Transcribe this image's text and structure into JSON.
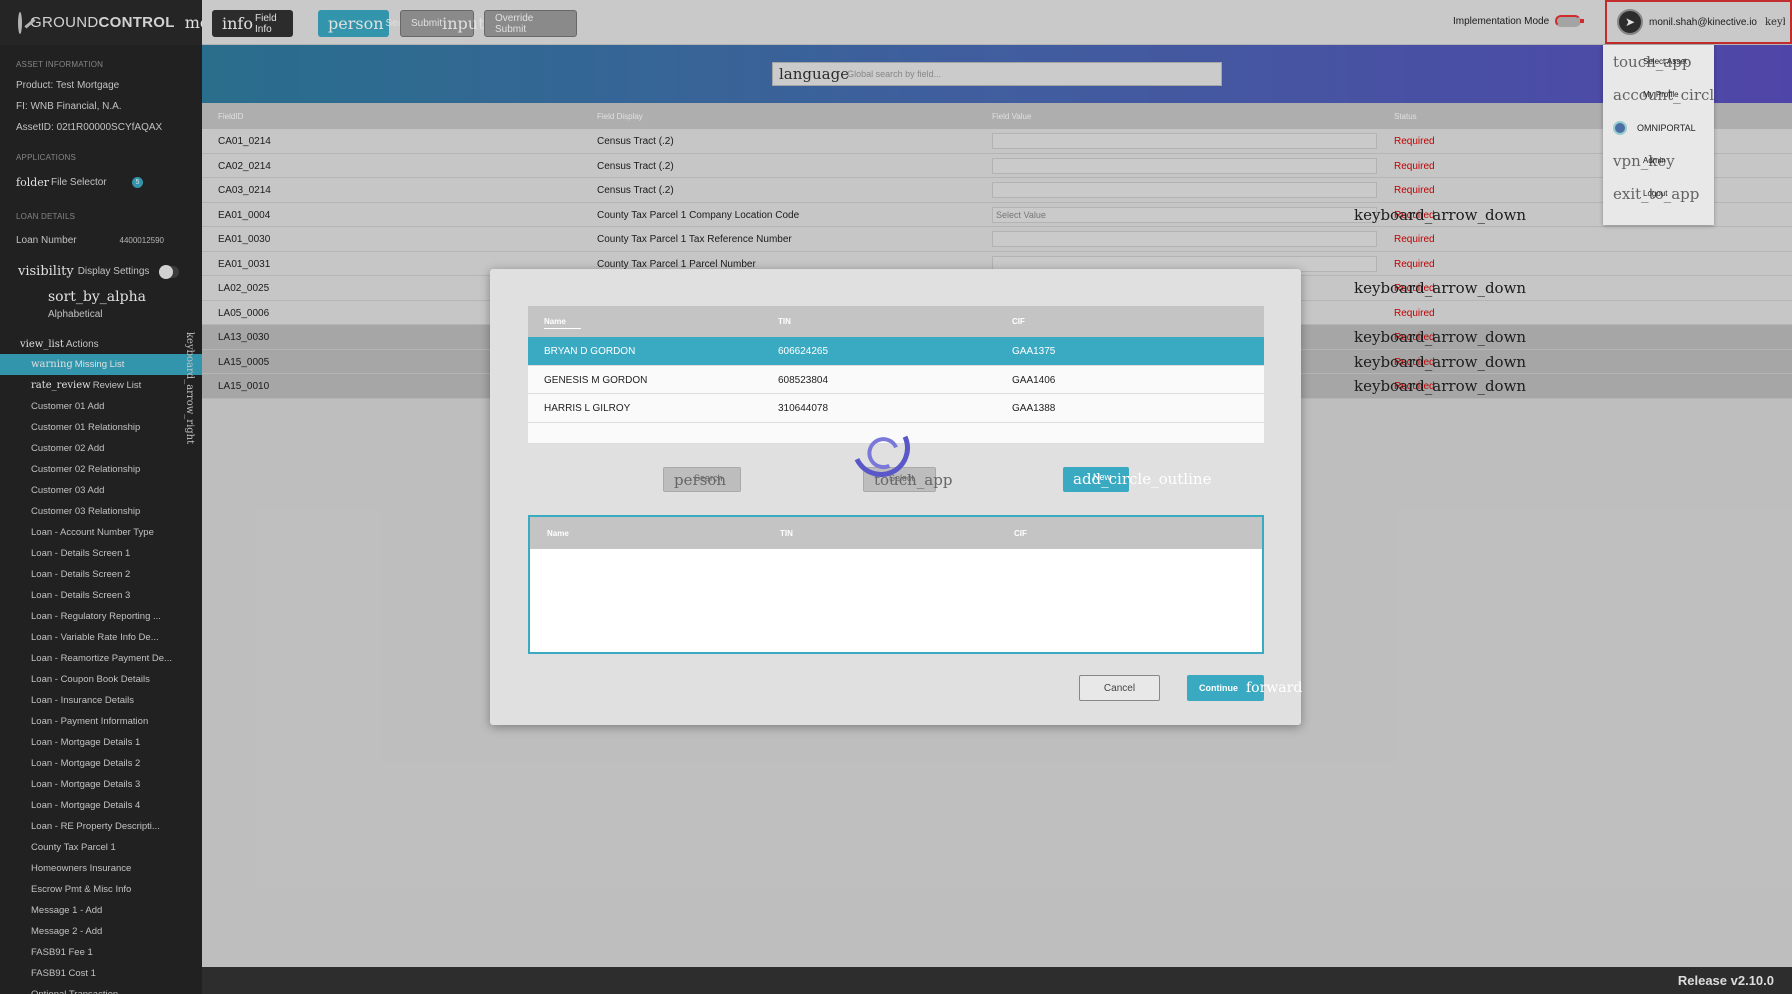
{
  "brand": {
    "name_light": "GROUND",
    "name_bold": "CONTROL",
    "menu_glyph": "menu"
  },
  "sidebar": {
    "asset_title": "ASSET INFORMATION",
    "product": "Product:  Test Mortgage",
    "fi": "FI:  WNB Financial, N.A.",
    "asset_id": "AssetID:  02t1R00000SCYfAQAX",
    "applications_title": "APPLICATIONS",
    "app_icon": "folder",
    "app_label": "File Selector",
    "app_badge": "5",
    "loan_title": "LOAN DETAILS",
    "loan_label": "Loan Number",
    "loan_value": "4400012590",
    "display_icon": "visibility",
    "display_label": "Display Settings",
    "sort_glyph": "sort_by_alpha",
    "sort_label": "Alphabetical",
    "actions_icon": "view_list",
    "actions_label": "Actions",
    "vertical_glyph": "keyboard_arrow_right",
    "items": [
      {
        "glyph": "warning",
        "label": "Missing List",
        "active": true
      },
      {
        "glyph": "rate_review",
        "label": "Review List"
      },
      {
        "label": "Customer 01 Add"
      },
      {
        "label": "Customer 01 Relationship"
      },
      {
        "label": "Customer 02 Add"
      },
      {
        "label": "Customer 02 Relationship"
      },
      {
        "label": "Customer 03 Add"
      },
      {
        "label": "Customer 03 Relationship"
      },
      {
        "label": "Loan - Account Number Type"
      },
      {
        "label": "Loan - Details Screen 1"
      },
      {
        "label": "Loan - Details Screen 2"
      },
      {
        "label": "Loan - Details Screen 3"
      },
      {
        "label": "Loan - Regulatory Reporting ..."
      },
      {
        "label": "Loan - Variable Rate Info De..."
      },
      {
        "label": "Loan - Reamortize Payment De..."
      },
      {
        "label": "Loan - Coupon Book Details"
      },
      {
        "label": "Loan - Insurance Details"
      },
      {
        "label": "Loan - Payment Information"
      },
      {
        "label": "Loan - Mortgage Details 1"
      },
      {
        "label": "Loan - Mortgage Details 2"
      },
      {
        "label": "Loan - Mortgage Details 3"
      },
      {
        "label": "Loan - Mortgage Details 4"
      },
      {
        "label": "Loan - RE Property Descripti..."
      },
      {
        "label": "County Tax Parcel 1"
      },
      {
        "label": "Homeowners Insurance"
      },
      {
        "label": "Escrow Pmt & Misc Info"
      },
      {
        "label": "Message 1 - Add"
      },
      {
        "label": "Message 2 - Add"
      },
      {
        "label": "FASB91 Fee 1"
      },
      {
        "label": "FASB91 Cost 1"
      },
      {
        "label": "Optional Transaction"
      }
    ]
  },
  "toolbar": {
    "field_info_glyph": "info",
    "field_info_label": "Field Info",
    "search_glyph": "person",
    "search_label": "Search",
    "submit_label": "Submit",
    "submit_glyph": "input",
    "override_label": "Override Submit",
    "impl_label": "Implementation Mode",
    "user_email": "monil.shah@kinective.io",
    "user_glyph": "keyboard_arrow_down"
  },
  "dropdown": [
    {
      "glyph": "touch_app",
      "label": "Select Asset"
    },
    {
      "glyph": "account_circle",
      "label": "My Profile"
    },
    {
      "glyph": "",
      "label": "OMNIPORTAL"
    },
    {
      "glyph": "vpn_key",
      "label": "Admin"
    },
    {
      "glyph": "exit_to_app",
      "label": "Logout"
    }
  ],
  "search": {
    "glyph": "language",
    "placeholder": "Global search by field..."
  },
  "table": {
    "headers": [
      "FieldID",
      "Field Display",
      "Field Value",
      "Status"
    ],
    "rows": [
      {
        "id": "CA01_0214",
        "display": "Census Tract (.2)",
        "value": "",
        "status": "Required"
      },
      {
        "id": "CA02_0214",
        "display": "Census Tract (.2)",
        "value": "",
        "status": "Required"
      },
      {
        "id": "CA03_0214",
        "display": "Census Tract (.2)",
        "value": "",
        "status": "Required"
      },
      {
        "id": "EA01_0004",
        "display": "County Tax Parcel 1 Company Location Code",
        "value": "Select Value",
        "status": "Required",
        "dropdown": "keyboard_arrow_down"
      },
      {
        "id": "EA01_0030",
        "display": "County Tax Parcel 1 Tax Reference Number",
        "value": "",
        "status": "Required"
      },
      {
        "id": "EA01_0031",
        "display": "County Tax Parcel 1 Parcel Number",
        "value": "",
        "status": "Required"
      },
      {
        "id": "LA02_0025",
        "display": "",
        "value": "",
        "status": "Required",
        "dropdown": "keyboard_arrow_down"
      },
      {
        "id": "LA05_0006",
        "display": "",
        "value": "",
        "status": "Required"
      },
      {
        "id": "LA13_0030",
        "display": "",
        "value": "",
        "status": "Required",
        "dropdown": "keyboard_arrow_down",
        "dim": true
      },
      {
        "id": "LA15_0005",
        "display": "",
        "value": "",
        "status": "Required",
        "dropdown": "keyboard_arrow_down",
        "dim": true
      },
      {
        "id": "LA15_0010",
        "display": "",
        "value": "",
        "status": "Required",
        "dropdown": "keyboard_arrow_down",
        "dim": true
      }
    ]
  },
  "modal": {
    "headers": [
      "Name",
      "TIN",
      "CIF"
    ],
    "rows": [
      {
        "name": "BRYAN D GORDON",
        "tin": "606624265",
        "cif": "GAA1375",
        "selected": true
      },
      {
        "name": "GENESIS M GORDON",
        "tin": "608523804",
        "cif": "GAA1406"
      },
      {
        "name": "HARRIS L GILROY",
        "tin": "310644078",
        "cif": "GAA1388"
      }
    ],
    "search_glyph": "person",
    "search_label": "Search",
    "select_glyph": "touch_app",
    "select_label": "Select",
    "new_glyph": "add_circle_outline",
    "new_label": "New",
    "selected_headers": [
      "Name",
      "TIN",
      "CIF"
    ],
    "cancel_label": "Cancel",
    "continue_label": "Continue",
    "continue_glyph": "forward"
  },
  "footer": {
    "release": "Release v2.10.0"
  },
  "colors": {
    "accent": "#3aaac3",
    "sidebar": "#262626",
    "required": "#dd0000"
  }
}
